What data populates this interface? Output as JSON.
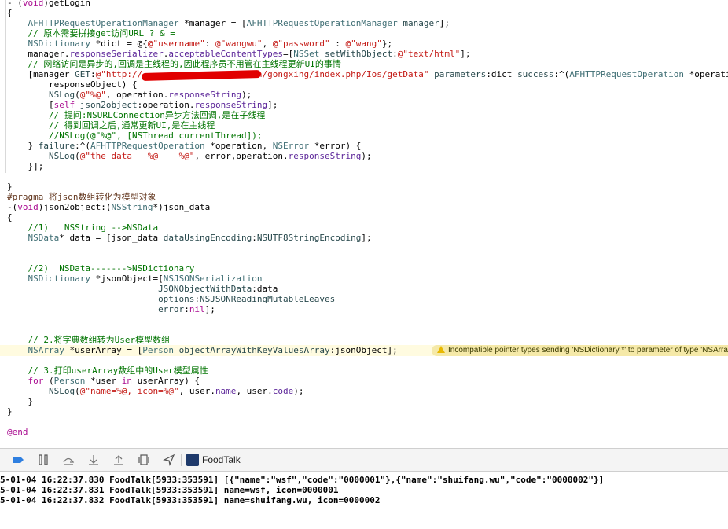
{
  "editor": {
    "lines": [
      {
        "segs": [
          [
            "ann",
            "- ("
          ],
          [
            "kw",
            "void"
          ],
          [
            "ann",
            ")getLogin"
          ]
        ]
      },
      {
        "segs": [
          [
            "ann",
            "{"
          ]
        ]
      },
      {
        "segs": [
          [
            "ann",
            "    "
          ],
          [
            "cls",
            "AFHTTPRequestOperationManager"
          ],
          [
            "ann",
            " *manager = ["
          ],
          [
            "cls",
            "AFHTTPRequestOperationManager"
          ],
          [
            "ann",
            " "
          ],
          [
            "mth",
            "manager"
          ],
          [
            "ann",
            "];"
          ]
        ]
      },
      {
        "segs": [
          [
            "ann",
            "    "
          ],
          [
            "cmt",
            "// 原本需要拼接get访问URL ? & ="
          ]
        ]
      },
      {
        "segs": [
          [
            "ann",
            "    "
          ],
          [
            "cls",
            "NSDictionary"
          ],
          [
            "ann",
            " *dict = @{"
          ],
          [
            "str",
            "@\"username\""
          ],
          [
            "ann",
            ": "
          ],
          [
            "str",
            "@\"wangwu\""
          ],
          [
            "ann",
            ", "
          ],
          [
            "str",
            "@\"password\""
          ],
          [
            "ann",
            " : "
          ],
          [
            "str",
            "@\"wang\""
          ],
          [
            "ann",
            "};"
          ]
        ]
      },
      {
        "segs": [
          [
            "ann",
            "    manager."
          ],
          [
            "prop",
            "responseSerializer"
          ],
          [
            "ann",
            "."
          ],
          [
            "prop",
            "acceptableContentTypes"
          ],
          [
            "ann",
            "=["
          ],
          [
            "cls",
            "NSSet"
          ],
          [
            "ann",
            " "
          ],
          [
            "mth",
            "setWithObject"
          ],
          [
            "ann",
            ":"
          ],
          [
            "str",
            "@\"text/html\""
          ],
          [
            "ann",
            "];"
          ]
        ]
      },
      {
        "segs": [
          [
            "ann",
            "    "
          ],
          [
            "cmt",
            "// 网络访问是异步的,回调是主线程的,因此程序员不用管在主线程更新UI的事情"
          ]
        ]
      },
      {
        "segs": [
          [
            "ann",
            "    [manager "
          ],
          [
            "mth",
            "GET"
          ],
          [
            "ann",
            ":"
          ],
          [
            "str",
            "@\"http://"
          ],
          [
            "ann",
            "                    "
          ],
          [
            "str",
            ".cn/gongxing/index.php/Ios/getData\""
          ],
          [
            "ann",
            " "
          ],
          [
            "mth",
            "parameters"
          ],
          [
            "ann",
            ":dict "
          ],
          [
            "mth",
            "success"
          ],
          [
            "ann",
            ":^("
          ],
          [
            "cls",
            "AFHTTPRequestOperation"
          ],
          [
            "ann",
            " *operation, "
          ],
          [
            "kw",
            "id"
          ]
        ]
      },
      {
        "segs": [
          [
            "ann",
            "        responseObject) {"
          ]
        ]
      },
      {
        "segs": [
          [
            "ann",
            "        "
          ],
          [
            "mth",
            "NSLog"
          ],
          [
            "ann",
            "("
          ],
          [
            "str",
            "@\"%@\""
          ],
          [
            "ann",
            ", operation."
          ],
          [
            "prop",
            "responseString"
          ],
          [
            "ann",
            ");"
          ]
        ]
      },
      {
        "segs": [
          [
            "ann",
            "        ["
          ],
          [
            "kw",
            "self"
          ],
          [
            "ann",
            " "
          ],
          [
            "mth",
            "json2object"
          ],
          [
            "ann",
            ":operation."
          ],
          [
            "prop",
            "responseString"
          ],
          [
            "ann",
            "];"
          ]
        ]
      },
      {
        "segs": [
          [
            "ann",
            "        "
          ],
          [
            "cmt",
            "// 提问:NSURLConnection异步方法回调,是在子线程"
          ]
        ]
      },
      {
        "segs": [
          [
            "ann",
            "        "
          ],
          [
            "cmt",
            "// 得到回调之后,通常更新UI,是在主线程"
          ]
        ]
      },
      {
        "segs": [
          [
            "ann",
            "        "
          ],
          [
            "cmt",
            "//NSLog(@\"%@\", [NSThread currentThread]);"
          ]
        ]
      },
      {
        "segs": [
          [
            "ann",
            "    } "
          ],
          [
            "mth",
            "failure"
          ],
          [
            "ann",
            ":^("
          ],
          [
            "cls",
            "AFHTTPRequestOperation"
          ],
          [
            "ann",
            " *operation, "
          ],
          [
            "cls",
            "NSError"
          ],
          [
            "ann",
            " *error) {"
          ]
        ]
      },
      {
        "segs": [
          [
            "ann",
            "        "
          ],
          [
            "mth",
            "NSLog"
          ],
          [
            "ann",
            "("
          ],
          [
            "str",
            "@\"the data   %@    %@\""
          ],
          [
            "ann",
            ", error,operation."
          ],
          [
            "prop",
            "responseString"
          ],
          [
            "ann",
            ");"
          ]
        ]
      },
      {
        "segs": [
          [
            "ann",
            "    }];"
          ]
        ]
      },
      {
        "segs": [
          [
            "ann",
            ""
          ]
        ]
      },
      {
        "segs": [
          [
            "ann",
            "}"
          ]
        ]
      },
      {
        "segs": [
          [
            "pre",
            "#pragma 将json数组转化为模型对象"
          ]
        ]
      },
      {
        "segs": [
          [
            "ann",
            "-("
          ],
          [
            "kw",
            "void"
          ],
          [
            "ann",
            ")json2object:("
          ],
          [
            "cls",
            "NSString"
          ],
          [
            "ann",
            "*)json_data"
          ]
        ]
      },
      {
        "segs": [
          [
            "ann",
            "{"
          ]
        ]
      },
      {
        "segs": [
          [
            "ann",
            "    "
          ],
          [
            "cmt",
            "//1)   NSString -->NSData"
          ]
        ]
      },
      {
        "segs": [
          [
            "ann",
            "    "
          ],
          [
            "cls",
            "NSData"
          ],
          [
            "ann",
            "* data = [json_data "
          ],
          [
            "mth",
            "dataUsingEncoding"
          ],
          [
            "ann",
            ":"
          ],
          [
            "mth",
            "NSUTF8StringEncoding"
          ],
          [
            "ann",
            "];"
          ]
        ]
      },
      {
        "segs": [
          [
            "ann",
            ""
          ]
        ]
      },
      {
        "segs": [
          [
            "ann",
            ""
          ]
        ]
      },
      {
        "segs": [
          [
            "ann",
            "    "
          ],
          [
            "cmt",
            "//2)  NSData------->NSDictionary"
          ]
        ]
      },
      {
        "segs": [
          [
            "ann",
            "    "
          ],
          [
            "cls",
            "NSDictionary"
          ],
          [
            "ann",
            " *jsonObject=["
          ],
          [
            "cls",
            "NSJSONSerialization"
          ]
        ]
      },
      {
        "segs": [
          [
            "ann",
            "                             "
          ],
          [
            "mth",
            "JSONObjectWithData"
          ],
          [
            "ann",
            ":data"
          ]
        ]
      },
      {
        "segs": [
          [
            "ann",
            "                             "
          ],
          [
            "mth",
            "options"
          ],
          [
            "ann",
            ":"
          ],
          [
            "mth",
            "NSJSONReadingMutableLeaves"
          ]
        ]
      },
      {
        "segs": [
          [
            "ann",
            "                             "
          ],
          [
            "mth",
            "error"
          ],
          [
            "ann",
            ":"
          ],
          [
            "kw",
            "nil"
          ],
          [
            "ann",
            "];"
          ]
        ]
      },
      {
        "segs": [
          [
            "ann",
            ""
          ]
        ]
      },
      {
        "segs": [
          [
            "ann",
            ""
          ]
        ]
      },
      {
        "segs": [
          [
            "ann",
            "    "
          ],
          [
            "cmt",
            "// 2.将字典数组转为User模型数组"
          ]
        ]
      },
      {
        "segs": [
          [
            "ann",
            "    "
          ],
          [
            "cls",
            "NSArray"
          ],
          [
            "ann",
            " *userArray = ["
          ],
          [
            "cls",
            "Person"
          ],
          [
            "ann",
            " "
          ],
          [
            "mth",
            "objectArrayWithKeyValuesArray"
          ],
          [
            "ann",
            ":jsonObject];"
          ]
        ]
      },
      {
        "segs": [
          [
            "ann",
            ""
          ]
        ]
      },
      {
        "segs": [
          [
            "ann",
            "    "
          ],
          [
            "cmt",
            "// 3.打印userArray数组中的User模型属性"
          ]
        ]
      },
      {
        "segs": [
          [
            "ann",
            "    "
          ],
          [
            "kw",
            "for"
          ],
          [
            "ann",
            " ("
          ],
          [
            "cls",
            "Person"
          ],
          [
            "ann",
            " *user "
          ],
          [
            "kw",
            "in"
          ],
          [
            "ann",
            " userArray) {"
          ]
        ]
      },
      {
        "segs": [
          [
            "ann",
            "        "
          ],
          [
            "mth",
            "NSLog"
          ],
          [
            "ann",
            "("
          ],
          [
            "str",
            "@\"name=%@, icon=%@\""
          ],
          [
            "ann",
            ", user."
          ],
          [
            "prop",
            "name"
          ],
          [
            "ann",
            ", user."
          ],
          [
            "prop",
            "code"
          ],
          [
            "ann",
            ");"
          ]
        ]
      },
      {
        "segs": [
          [
            "ann",
            "    }"
          ]
        ]
      },
      {
        "segs": [
          [
            "ann",
            "}"
          ]
        ]
      },
      {
        "segs": [
          [
            "ann",
            ""
          ]
        ]
      },
      {
        "segs": [
          [
            "kw",
            "@end"
          ]
        ]
      }
    ],
    "warning": "Incompatible pointer types sending 'NSDictionary *' to parameter of type 'NSArray"
  },
  "debugbar": {
    "buttons": [
      {
        "name": "breakpoints-toggle-icon"
      },
      {
        "name": "pause-icon"
      },
      {
        "name": "step-over-icon"
      },
      {
        "name": "step-into-icon"
      },
      {
        "name": "step-out-icon"
      },
      {
        "name": "view-hierarchy-icon"
      },
      {
        "name": "location-icon"
      }
    ],
    "app_name": "FoodTalk"
  },
  "console": {
    "lines": [
      "5-01-04 16:22:37.830 FoodTalk[5933:353591] [{\"name\":\"wsf\",\"code\":\"0000001\"},{\"name\":\"shuifang.wu\",\"code\":\"0000002\"}]",
      "5-01-04 16:22:37.831 FoodTalk[5933:353591] name=wsf, icon=0000001",
      "5-01-04 16:22:37.832 FoodTalk[5933:353591] name=shuifang.wu, icon=0000002"
    ]
  }
}
